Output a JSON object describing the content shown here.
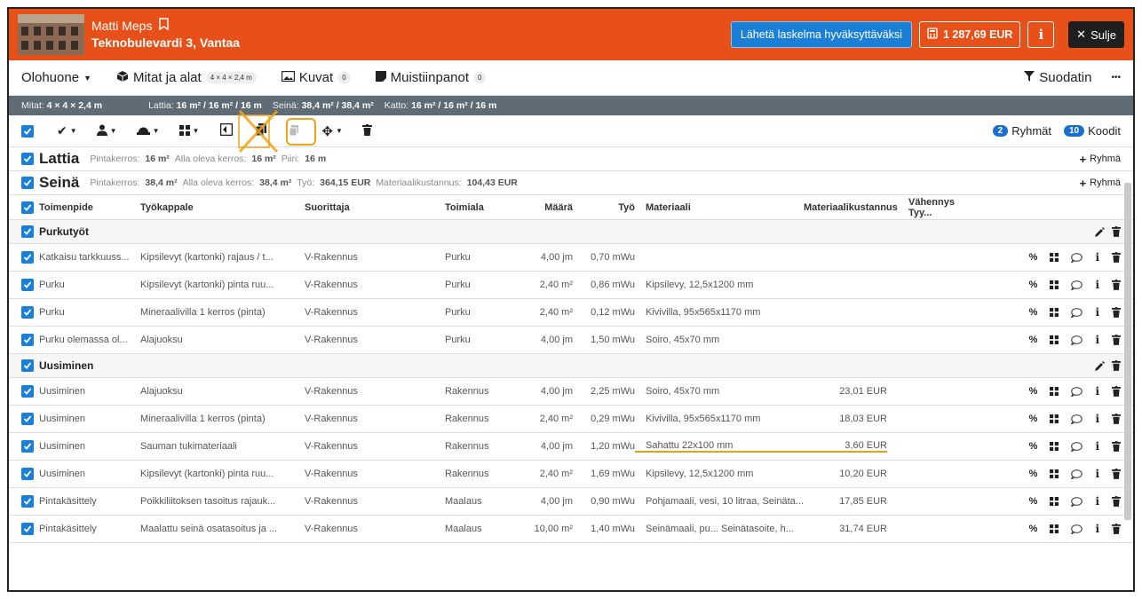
{
  "header": {
    "client_name": "Matti Meps",
    "address": "Teknobulevardi 3, Vantaa",
    "send_button": "Lähetä laskelma hyväksyttäväksi",
    "total": "1 287,69 EUR",
    "info_label": "i",
    "close_label": "Sulje"
  },
  "nav": {
    "room": "Olohuone",
    "dims_tab": "Mitat ja alat",
    "dims_pill": "4 × 4 × 2,4 m",
    "photos_tab": "Kuvat",
    "photos_count": "0",
    "notes_tab": "Muistiinpanot",
    "notes_count": "0",
    "filter": "Suodatin",
    "more": "•••"
  },
  "dims": {
    "mitat_k": "Mitat:",
    "mitat_v": "4 × 4 × 2,4 m",
    "lattia_k": "Lattia:",
    "lattia_v": "16 m² / 16 m² / 16 m",
    "seina_k": "Seinä:",
    "seina_v": "38,4 m² / 38,4 m²",
    "katto_k": "Katto:",
    "katto_v": "16 m² / 16 m² / 16 m"
  },
  "toolbar": {
    "groups_count": "2",
    "groups_label": "Ryhmät",
    "codes_count": "10",
    "codes_label": "Koodit"
  },
  "sections": {
    "lattia": {
      "title": "Lattia",
      "k1": "Pintakerros:",
      "v1": "16 m²",
      "k2": "Alla oleva kerros:",
      "v2": "16 m²",
      "k3": "Piiri:",
      "v3": "16 m",
      "group_btn": "Ryhmä"
    },
    "seina": {
      "title": "Seinä",
      "k1": "Pintakerros:",
      "v1": "38,4 m²",
      "k2": "Alla oleva kerros:",
      "v2": "38,4 m²",
      "k3": "Työ:",
      "v3": "364,15 EUR",
      "k4": "Materiaalikustannus:",
      "v4": "104,43 EUR",
      "group_btn": "Ryhmä"
    }
  },
  "columns": {
    "toimenpide": "Toimenpide",
    "tyokappale": "Työkappale",
    "suorittaja": "Suorittaja",
    "toimiala": "Toimiala",
    "maara": "Määrä",
    "tyo": "Työ",
    "materiaali": "Materiaali",
    "kustannus": "Materiaalikustannus",
    "vahennys": "Vähennys Tyy..."
  },
  "groups": [
    {
      "name": "Purkutyöt",
      "rows": [
        {
          "op": "Katkaisu tarkkuuss...",
          "piece": "Kipsilevyt (kartonki) rajaus / t...",
          "by": "V-Rakennus",
          "field": "Purku",
          "qty": "4,00 jm",
          "work": "0,70 mWu",
          "mat": "",
          "cost": ""
        },
        {
          "op": "Purku",
          "piece": "Kipsilevyt (kartonki) pinta ruu...",
          "by": "V-Rakennus",
          "field": "Purku",
          "qty": "2,40 m²",
          "work": "0,86 mWu",
          "mat": "Kipsilevy, 12,5x1200 mm",
          "cost": ""
        },
        {
          "op": "Purku",
          "piece": "Mineraalivilla 1 kerros (pinta)",
          "by": "V-Rakennus",
          "field": "Purku",
          "qty": "2,40 m²",
          "work": "0,12 mWu",
          "mat": "Kivivilla, 95x565x1170 mm",
          "cost": ""
        },
        {
          "op": "Purku olemassa ol...",
          "piece": "Alajuoksu",
          "by": "V-Rakennus",
          "field": "Purku",
          "qty": "4,00 jm",
          "work": "1,50 mWu",
          "mat": "Soiro, 45x70 mm",
          "cost": ""
        }
      ]
    },
    {
      "name": "Uusiminen",
      "rows": [
        {
          "op": "Uusiminen",
          "piece": "Alajuoksu",
          "by": "V-Rakennus",
          "field": "Rakennus",
          "qty": "4,00 jm",
          "work": "2,25 mWu",
          "mat": "Soiro, 45x70 mm",
          "cost": "23,01 EUR"
        },
        {
          "op": "Uusiminen",
          "piece": "Mineraalivilla 1 kerros (pinta)",
          "by": "V-Rakennus",
          "field": "Rakennus",
          "qty": "2,40 m²",
          "work": "0,29 mWu",
          "mat": "Kivivilla, 95x565x1170 mm",
          "cost": "18,03 EUR"
        },
        {
          "op": "Uusiminen",
          "piece": "Sauman tukimateriaali",
          "by": "V-Rakennus",
          "field": "Rakennus",
          "qty": "4,00 jm",
          "work": "1,20 mWu",
          "mat": "Sahattu 22x100 mm",
          "cost": "3,60 EUR"
        },
        {
          "op": "Uusiminen",
          "piece": "Kipsilevyt (kartonki) pinta ruu...",
          "by": "V-Rakennus",
          "field": "Rakennus",
          "qty": "2,40 m²",
          "work": "1,69 mWu",
          "mat": "Kipsilevy, 12,5x1200 mm",
          "cost": "10,20 EUR"
        },
        {
          "op": "Pintakäsittely",
          "piece": "Poikkiliitoksen tasoitus rajauk...",
          "by": "V-Rakennus",
          "field": "Maalaus",
          "qty": "4,00 jm",
          "work": "0,90 mWu",
          "mat": "Pohjamaali, vesi, 10 litraa, Seinäta...",
          "cost": "17,85 EUR"
        },
        {
          "op": "Pintakäsittely",
          "piece": "Maalattu seinä osatasoitus ja ...",
          "by": "V-Rakennus",
          "field": "Maalaus",
          "qty": "10,00 m²",
          "work": "1,40 mWu",
          "mat": "Seinämaali, pu...     Seinätasoite, h...",
          "cost": "31,74 EUR"
        }
      ]
    }
  ],
  "colors": {
    "brand": "#e8501a",
    "accent": "#1a7fd6",
    "highlight": "#f0a31a"
  }
}
